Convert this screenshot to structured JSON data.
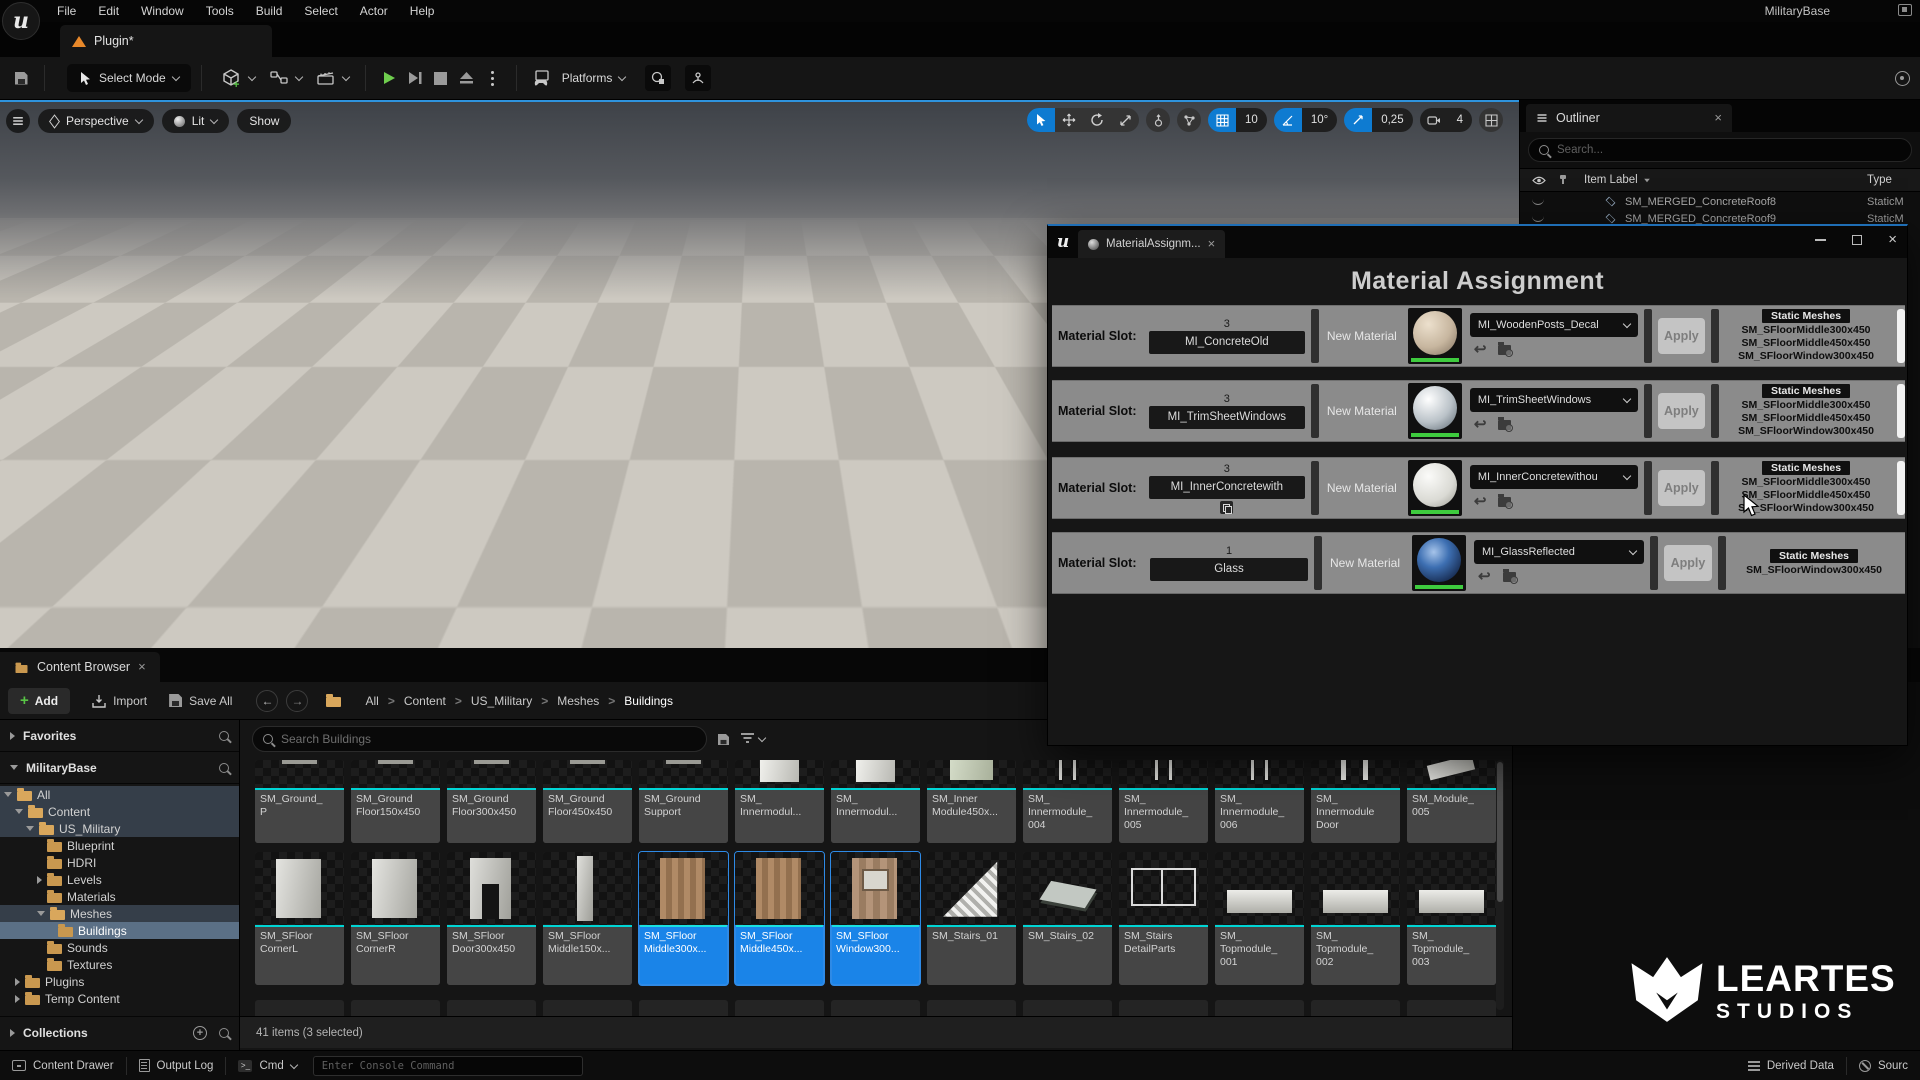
{
  "window": {
    "project": "MilitaryBase"
  },
  "menu": {
    "items": [
      "File",
      "Edit",
      "Window",
      "Tools",
      "Build",
      "Select",
      "Actor",
      "Help"
    ]
  },
  "tabs": {
    "level_tab": "Plugin*"
  },
  "toolbar": {
    "select_mode": "Select Mode",
    "platforms": "Platforms"
  },
  "viewport": {
    "pills": [
      "Perspective",
      "Lit",
      "Show"
    ],
    "snaps": {
      "grid": "10",
      "angle": "10°",
      "scale": "0,25",
      "camera_speed": "4"
    }
  },
  "outliner": {
    "tab": "Outliner",
    "search_placeholder": "Search...",
    "columns": {
      "item": "Item Label",
      "type": "Type"
    },
    "rows": [
      {
        "label": "SM_MERGED_ConcreteRoof8",
        "type": "StaticM"
      },
      {
        "label": "SM_MERGED_ConcreteRoof9",
        "type": "StaticM"
      }
    ]
  },
  "material_window": {
    "tab": "MaterialAssignm...",
    "title": "Material Assignment",
    "slot_label": "Material Slot:",
    "new_material_label": "New Material",
    "apply_label": "Apply",
    "meshes_header": "Static Meshes",
    "rows": [
      {
        "count": "3",
        "slot": "MI_ConcreteOld",
        "material": "MI_WoodenPosts_Decal",
        "sphere": "beige",
        "copy_badge": false,
        "scrollbar": true,
        "meshes": [
          "SM_SFloorMiddle300x450",
          "SM_SFloorMiddle450x450",
          "SM_SFloorWindow300x450"
        ]
      },
      {
        "count": "3",
        "slot": "MI_TrimSheetWindows",
        "material": "MI_TrimSheetWindows",
        "sphere": "silver",
        "copy_badge": false,
        "scrollbar": true,
        "meshes": [
          "SM_SFloorMiddle300x450",
          "SM_SFloorMiddle450x450",
          "SM_SFloorWindow300x450"
        ]
      },
      {
        "count": "3",
        "slot": "MI_InnerConcretewith",
        "material": "MI_InnerConcretewithou",
        "sphere": "white",
        "copy_badge": true,
        "scrollbar": true,
        "meshes": [
          "SM_SFloorMiddle300x450",
          "SM_SFloorMiddle450x450",
          "SM_SFloorWindow300x450"
        ]
      },
      {
        "count": "1",
        "slot": "Glass",
        "material": "MI_GlassReflected",
        "sphere": "glass",
        "copy_badge": false,
        "scrollbar": false,
        "meshes": [
          "SM_SFloorWindow300x450"
        ]
      }
    ]
  },
  "content_browser": {
    "tab": "Content Browser",
    "add": "Add",
    "import": "Import",
    "save_all": "Save All",
    "breadcrumb": [
      "All",
      "Content",
      "US_Military",
      "Meshes",
      "Buildings"
    ],
    "breadcrumb_sep": ">",
    "search_placeholder": "Search Buildings",
    "sections": {
      "favorites": "Favorites",
      "project": "MilitaryBase",
      "collections": "Collections"
    },
    "tree": [
      {
        "label": "All",
        "depth": 0,
        "arrow": "down",
        "open": true,
        "hl": "dim"
      },
      {
        "label": "Content",
        "depth": 1,
        "arrow": "down",
        "open": true,
        "hl": "dim"
      },
      {
        "label": "US_Military",
        "depth": 2,
        "arrow": "down",
        "open": true,
        "hl": "dim"
      },
      {
        "label": "Blueprint",
        "depth": 3,
        "arrow": "none",
        "open": false,
        "hl": "none"
      },
      {
        "label": "HDRI",
        "depth": 3,
        "arrow": "none",
        "open": false,
        "hl": "none"
      },
      {
        "label": "Levels",
        "depth": 3,
        "arrow": "right",
        "open": false,
        "hl": "none"
      },
      {
        "label": "Materials",
        "depth": 3,
        "arrow": "none",
        "open": false,
        "hl": "none"
      },
      {
        "label": "Meshes",
        "depth": 3,
        "arrow": "down",
        "open": true,
        "hl": "dim"
      },
      {
        "label": "Buildings",
        "depth": 4,
        "arrow": "none",
        "open": false,
        "hl": "sel"
      },
      {
        "label": "Sounds",
        "depth": 3,
        "arrow": "none",
        "open": false,
        "hl": "none"
      },
      {
        "label": "Textures",
        "depth": 3,
        "arrow": "none",
        "open": false,
        "hl": "none"
      },
      {
        "label": "Plugins",
        "depth": 1,
        "arrow": "right",
        "open": false,
        "hl": "none"
      },
      {
        "label": "Temp Content",
        "depth": 1,
        "arrow": "right",
        "open": false,
        "hl": "none"
      }
    ],
    "assets_row1": [
      {
        "label": "SM_Ground_\nP",
        "thumb": "bit",
        "selected": false
      },
      {
        "label": "SM_Ground\nFloor150x450",
        "thumb": "bit",
        "selected": false
      },
      {
        "label": "SM_Ground\nFloor300x450",
        "thumb": "bit",
        "selected": false
      },
      {
        "label": "SM_Ground\nFloor450x450",
        "thumb": "bit",
        "selected": false
      },
      {
        "label": "SM_Ground\nSupport",
        "thumb": "bit",
        "selected": false
      },
      {
        "label": "SM_\nInnermodul...",
        "thumb": "panel",
        "selected": false
      },
      {
        "label": "SM_\nInnermodul...",
        "thumb": "panel",
        "selected": false
      },
      {
        "label": "SM_Inner\nModule450x...",
        "thumb": "panel-green",
        "selected": false
      },
      {
        "label": "SM_\nInnermodule_\n004",
        "thumb": "post",
        "selected": false
      },
      {
        "label": "SM_\nInnermodule_\n005",
        "thumb": "post",
        "selected": false
      },
      {
        "label": "SM_\nInnermodule_\n006",
        "thumb": "post",
        "selected": false
      },
      {
        "label": "SM_\nInnermodule\nDoor",
        "thumb": "post2",
        "selected": false
      },
      {
        "label": "SM_Module_\n005",
        "thumb": "angle",
        "selected": false
      }
    ],
    "assets_row2": [
      {
        "label": "SM_SFloor\nCornerL",
        "thumb": "slab",
        "selected": false
      },
      {
        "label": "SM_SFloor\nCornerR",
        "thumb": "slab",
        "selected": false
      },
      {
        "label": "SM_SFloor\nDoor300x450",
        "thumb": "door",
        "selected": false
      },
      {
        "label": "SM_SFloor\nMiddle150x...",
        "thumb": "thin",
        "selected": false
      },
      {
        "label": "SM_SFloor\nMiddle300x...",
        "thumb": "brown",
        "selected": true
      },
      {
        "label": "SM_SFloor\nMiddle450x...",
        "thumb": "brown",
        "selected": true
      },
      {
        "label": "SM_SFloor\nWindow300...",
        "thumb": "window",
        "selected": true
      },
      {
        "label": "SM_Stairs_01",
        "thumb": "stairs",
        "selected": false
      },
      {
        "label": "SM_Stairs_02",
        "thumb": "ramp",
        "selected": false
      },
      {
        "label": "SM_Stairs\nDetailParts",
        "thumb": "frame",
        "selected": false
      },
      {
        "label": "SM_\nTopmodule_\n001",
        "thumb": "block",
        "selected": false
      },
      {
        "label": "SM_\nTopmodule_\n002",
        "thumb": "block",
        "selected": false
      },
      {
        "label": "SM_\nTopmodule_\n003",
        "thumb": "block",
        "selected": false
      }
    ],
    "status": "41 items (3 selected)"
  },
  "bottom_bar": {
    "content_drawer": "Content Drawer",
    "output_log": "Output Log",
    "cmd": "Cmd",
    "console_placeholder": "Enter Console Command",
    "derived_data": "Derived Data",
    "source_control": "Sourc"
  },
  "logo": {
    "line1": "LEARTES",
    "line2": "STUDIOS"
  },
  "colors": {
    "accent_blue": "#0e7bd1",
    "selection_blue": "#1a84e8",
    "asset_line_cyan": "#00d4d4",
    "row_gray": "#8b8b8b",
    "folder_tan": "#c9984f",
    "play_green": "#6fce4e"
  }
}
